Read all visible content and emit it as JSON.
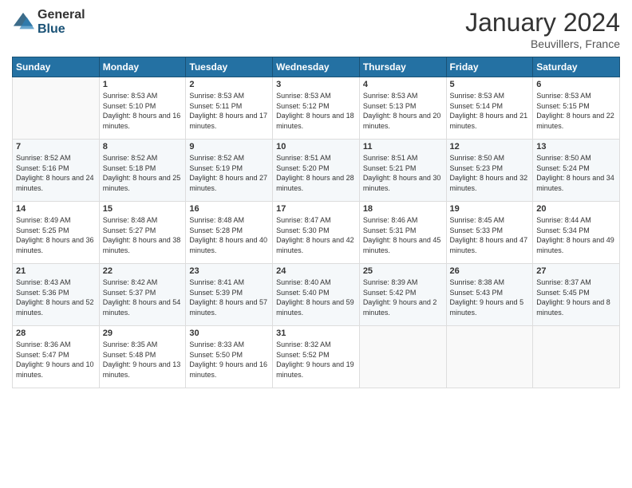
{
  "logo": {
    "general": "General",
    "blue": "Blue"
  },
  "title": "January 2024",
  "location": "Beuvillers, France",
  "days_of_week": [
    "Sunday",
    "Monday",
    "Tuesday",
    "Wednesday",
    "Thursday",
    "Friday",
    "Saturday"
  ],
  "weeks": [
    [
      {
        "day": "",
        "sunrise": "",
        "sunset": "",
        "daylight": ""
      },
      {
        "day": "1",
        "sunrise": "Sunrise: 8:53 AM",
        "sunset": "Sunset: 5:10 PM",
        "daylight": "Daylight: 8 hours and 16 minutes."
      },
      {
        "day": "2",
        "sunrise": "Sunrise: 8:53 AM",
        "sunset": "Sunset: 5:11 PM",
        "daylight": "Daylight: 8 hours and 17 minutes."
      },
      {
        "day": "3",
        "sunrise": "Sunrise: 8:53 AM",
        "sunset": "Sunset: 5:12 PM",
        "daylight": "Daylight: 8 hours and 18 minutes."
      },
      {
        "day": "4",
        "sunrise": "Sunrise: 8:53 AM",
        "sunset": "Sunset: 5:13 PM",
        "daylight": "Daylight: 8 hours and 20 minutes."
      },
      {
        "day": "5",
        "sunrise": "Sunrise: 8:53 AM",
        "sunset": "Sunset: 5:14 PM",
        "daylight": "Daylight: 8 hours and 21 minutes."
      },
      {
        "day": "6",
        "sunrise": "Sunrise: 8:53 AM",
        "sunset": "Sunset: 5:15 PM",
        "daylight": "Daylight: 8 hours and 22 minutes."
      }
    ],
    [
      {
        "day": "7",
        "sunrise": "Sunrise: 8:52 AM",
        "sunset": "Sunset: 5:16 PM",
        "daylight": "Daylight: 8 hours and 24 minutes."
      },
      {
        "day": "8",
        "sunrise": "Sunrise: 8:52 AM",
        "sunset": "Sunset: 5:18 PM",
        "daylight": "Daylight: 8 hours and 25 minutes."
      },
      {
        "day": "9",
        "sunrise": "Sunrise: 8:52 AM",
        "sunset": "Sunset: 5:19 PM",
        "daylight": "Daylight: 8 hours and 27 minutes."
      },
      {
        "day": "10",
        "sunrise": "Sunrise: 8:51 AM",
        "sunset": "Sunset: 5:20 PM",
        "daylight": "Daylight: 8 hours and 28 minutes."
      },
      {
        "day": "11",
        "sunrise": "Sunrise: 8:51 AM",
        "sunset": "Sunset: 5:21 PM",
        "daylight": "Daylight: 8 hours and 30 minutes."
      },
      {
        "day": "12",
        "sunrise": "Sunrise: 8:50 AM",
        "sunset": "Sunset: 5:23 PM",
        "daylight": "Daylight: 8 hours and 32 minutes."
      },
      {
        "day": "13",
        "sunrise": "Sunrise: 8:50 AM",
        "sunset": "Sunset: 5:24 PM",
        "daylight": "Daylight: 8 hours and 34 minutes."
      }
    ],
    [
      {
        "day": "14",
        "sunrise": "Sunrise: 8:49 AM",
        "sunset": "Sunset: 5:25 PM",
        "daylight": "Daylight: 8 hours and 36 minutes."
      },
      {
        "day": "15",
        "sunrise": "Sunrise: 8:48 AM",
        "sunset": "Sunset: 5:27 PM",
        "daylight": "Daylight: 8 hours and 38 minutes."
      },
      {
        "day": "16",
        "sunrise": "Sunrise: 8:48 AM",
        "sunset": "Sunset: 5:28 PM",
        "daylight": "Daylight: 8 hours and 40 minutes."
      },
      {
        "day": "17",
        "sunrise": "Sunrise: 8:47 AM",
        "sunset": "Sunset: 5:30 PM",
        "daylight": "Daylight: 8 hours and 42 minutes."
      },
      {
        "day": "18",
        "sunrise": "Sunrise: 8:46 AM",
        "sunset": "Sunset: 5:31 PM",
        "daylight": "Daylight: 8 hours and 45 minutes."
      },
      {
        "day": "19",
        "sunrise": "Sunrise: 8:45 AM",
        "sunset": "Sunset: 5:33 PM",
        "daylight": "Daylight: 8 hours and 47 minutes."
      },
      {
        "day": "20",
        "sunrise": "Sunrise: 8:44 AM",
        "sunset": "Sunset: 5:34 PM",
        "daylight": "Daylight: 8 hours and 49 minutes."
      }
    ],
    [
      {
        "day": "21",
        "sunrise": "Sunrise: 8:43 AM",
        "sunset": "Sunset: 5:36 PM",
        "daylight": "Daylight: 8 hours and 52 minutes."
      },
      {
        "day": "22",
        "sunrise": "Sunrise: 8:42 AM",
        "sunset": "Sunset: 5:37 PM",
        "daylight": "Daylight: 8 hours and 54 minutes."
      },
      {
        "day": "23",
        "sunrise": "Sunrise: 8:41 AM",
        "sunset": "Sunset: 5:39 PM",
        "daylight": "Daylight: 8 hours and 57 minutes."
      },
      {
        "day": "24",
        "sunrise": "Sunrise: 8:40 AM",
        "sunset": "Sunset: 5:40 PM",
        "daylight": "Daylight: 8 hours and 59 minutes."
      },
      {
        "day": "25",
        "sunrise": "Sunrise: 8:39 AM",
        "sunset": "Sunset: 5:42 PM",
        "daylight": "Daylight: 9 hours and 2 minutes."
      },
      {
        "day": "26",
        "sunrise": "Sunrise: 8:38 AM",
        "sunset": "Sunset: 5:43 PM",
        "daylight": "Daylight: 9 hours and 5 minutes."
      },
      {
        "day": "27",
        "sunrise": "Sunrise: 8:37 AM",
        "sunset": "Sunset: 5:45 PM",
        "daylight": "Daylight: 9 hours and 8 minutes."
      }
    ],
    [
      {
        "day": "28",
        "sunrise": "Sunrise: 8:36 AM",
        "sunset": "Sunset: 5:47 PM",
        "daylight": "Daylight: 9 hours and 10 minutes."
      },
      {
        "day": "29",
        "sunrise": "Sunrise: 8:35 AM",
        "sunset": "Sunset: 5:48 PM",
        "daylight": "Daylight: 9 hours and 13 minutes."
      },
      {
        "day": "30",
        "sunrise": "Sunrise: 8:33 AM",
        "sunset": "Sunset: 5:50 PM",
        "daylight": "Daylight: 9 hours and 16 minutes."
      },
      {
        "day": "31",
        "sunrise": "Sunrise: 8:32 AM",
        "sunset": "Sunset: 5:52 PM",
        "daylight": "Daylight: 9 hours and 19 minutes."
      },
      {
        "day": "",
        "sunrise": "",
        "sunset": "",
        "daylight": ""
      },
      {
        "day": "",
        "sunrise": "",
        "sunset": "",
        "daylight": ""
      },
      {
        "day": "",
        "sunrise": "",
        "sunset": "",
        "daylight": ""
      }
    ]
  ]
}
